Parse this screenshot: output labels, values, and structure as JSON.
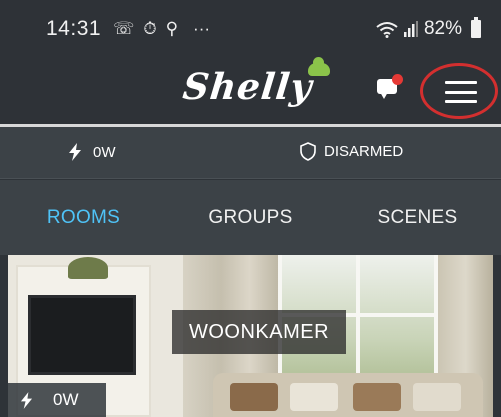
{
  "status_bar": {
    "time": "14:31",
    "notification_icons": [
      "whatsapp-icon",
      "timer-icon",
      "hotspot-icon"
    ],
    "overflow": "···",
    "battery": "82%"
  },
  "header": {
    "logo_text": "Shelly",
    "colors": {
      "logo_cloud": "#8bc34a",
      "notification_dot": "#e53935",
      "highlight_circle": "#d32f2f"
    }
  },
  "summary": {
    "power": "0W",
    "alarm_status": "DISARMED"
  },
  "tabs": [
    {
      "label": "ROOMS",
      "active": true
    },
    {
      "label": "GROUPS",
      "active": false
    },
    {
      "label": "SCENES",
      "active": false
    }
  ],
  "colors": {
    "accent": "#4fc3f7",
    "header_bg": "#2e3237",
    "strip_bg": "#3c4247"
  },
  "room": {
    "name": "WOONKAMER",
    "power": "0W"
  }
}
